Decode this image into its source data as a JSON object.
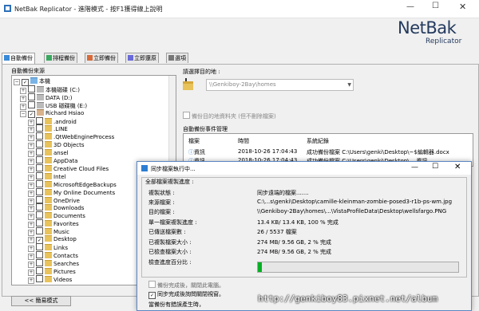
{
  "window": {
    "title": "NetBak Replicator - 進階模式 - 按F1獲得線上說明",
    "min": "—",
    "max": "☐",
    "close": "✕"
  },
  "logo": {
    "line1": "NetBak",
    "line2": "Replicator"
  },
  "tabs": [
    {
      "label": "自動備份",
      "active": true
    },
    {
      "label": "排程備份"
    },
    {
      "label": "立即備份"
    },
    {
      "label": "立即還原"
    },
    {
      "label": "選項"
    }
  ],
  "source": {
    "label": "自動備份來源",
    "tree": [
      {
        "label": "本機",
        "check": "checked",
        "icon": "pc",
        "expand": "−",
        "level": 0
      },
      {
        "label": "本機磁碟 (C:)",
        "check": "empty",
        "icon": "drv",
        "expand": "+",
        "level": 1
      },
      {
        "label": "DATA (D:)",
        "check": "empty",
        "icon": "drv",
        "expand": "+",
        "level": 1
      },
      {
        "label": "USB 磁碟機 (E:)",
        "check": "empty",
        "icon": "drv",
        "expand": "+",
        "level": 1
      },
      {
        "label": "Richard Hsiao",
        "check": "checked",
        "icon": "usr",
        "expand": "−",
        "level": 1
      },
      {
        "label": ".android",
        "check": "empty",
        "icon": "folder",
        "expand": "+",
        "level": 2
      },
      {
        "label": ".LINE",
        "check": "empty",
        "icon": "folder",
        "expand": "+",
        "level": 2
      },
      {
        "label": ".QtWebEngineProcess",
        "check": "empty",
        "icon": "folder",
        "expand": "+",
        "level": 2
      },
      {
        "label": "3D Objects",
        "check": "empty",
        "icon": "folder",
        "expand": "+",
        "level": 2
      },
      {
        "label": "ansel",
        "check": "empty",
        "icon": "folder",
        "expand": "+",
        "level": 2
      },
      {
        "label": "AppData",
        "check": "empty",
        "icon": "folder",
        "expand": "+",
        "level": 2
      },
      {
        "label": "Creative Cloud Files",
        "check": "empty",
        "icon": "folder",
        "expand": "+",
        "level": 2
      },
      {
        "label": "Intel",
        "check": "empty",
        "icon": "folder",
        "expand": "+",
        "level": 2
      },
      {
        "label": "MicrosoftEdgeBackups",
        "check": "empty",
        "icon": "folder",
        "expand": "+",
        "level": 2
      },
      {
        "label": "My Online Documents",
        "check": "empty",
        "icon": "folder",
        "expand": "+",
        "level": 2
      },
      {
        "label": "OneDrive",
        "check": "empty",
        "icon": "folder",
        "expand": "+",
        "level": 2
      },
      {
        "label": "Downloads",
        "check": "empty",
        "icon": "folder",
        "expand": "+",
        "level": 2
      },
      {
        "label": "Documents",
        "check": "empty",
        "icon": "folder",
        "expand": "+",
        "level": 2
      },
      {
        "label": "Favorites",
        "check": "empty",
        "icon": "folder",
        "expand": "+",
        "level": 2
      },
      {
        "label": "Music",
        "check": "empty",
        "icon": "folder",
        "expand": "+",
        "level": 2
      },
      {
        "label": "Desktop",
        "check": "checked",
        "icon": "folder",
        "expand": "+",
        "level": 2
      },
      {
        "label": "Links",
        "check": "empty",
        "icon": "folder",
        "expand": "+",
        "level": 2
      },
      {
        "label": "Contacts",
        "check": "empty",
        "icon": "folder",
        "expand": "+",
        "level": 2
      },
      {
        "label": "Searches",
        "check": "empty",
        "icon": "folder",
        "expand": "+",
        "level": 2
      },
      {
        "label": "Pictures",
        "check": "empty",
        "icon": "folder",
        "expand": "+",
        "level": 2
      },
      {
        "label": "Videos",
        "check": "empty",
        "icon": "folder",
        "expand": "+",
        "level": 2
      }
    ]
  },
  "simple_mode_button": "<< 簡易模式",
  "destination": {
    "label": "請選擇目的地 :",
    "value": "\\\\Genkiboy-2Bay\\homes",
    "mirror_label": "備份目的地資料夾 (但不刪除檔案)"
  },
  "events": {
    "label": "自動備份事件管理",
    "headers": [
      "檔案",
      "時間",
      "系統紀錄"
    ],
    "rows": [
      {
        "type": "資訊",
        "time": "2018-10-26 17:04:43",
        "log": "成功備份檔案 C:\\Users\\genki\\Desktop\\~$編輯器.docx"
      },
      {
        "type": "資訊",
        "time": "2018-10-26 17:04:43",
        "log": "成功備份檔案 C:\\Users\\genki\\Desktop\\... 資訊"
      }
    ]
  },
  "dialog": {
    "title": "同步檔案執行中...",
    "box_title": "全部檔案複製進度 :",
    "labels": {
      "status": "複製狀態 :",
      "source": "來源檔案 :",
      "target": "目的檔案 :",
      "single": "單一檔案複製進度 :",
      "transferred": "已傳送檔案數 :",
      "copied_size": "已複製檔案大小 :",
      "checked_size": "已檢查檔案大小 :",
      "check_pct": "檢查進度百分比 :"
    },
    "values": {
      "status": "同步遠端的檔案.......",
      "source": "C:\\...s\\genki\\Desktop\\camille-kleinman-zombie-posed3-r1b-ps-wm.jpg",
      "target": "\\\\Genkiboy-2Bay\\homes\\...\\VistaProfileData\\Desktop\\wellsfargo.PNG",
      "single": "13.4 KB/ 13.4 KB,   100 % 完成",
      "transferred": "26 / 5537 檔案",
      "copied_size": "274 MB/ 9.56 GB,   2 % 完成",
      "checked_size": "274 MB/ 9.56 GB,   2 % 完成"
    },
    "progress_fraction": 0.02,
    "check_close_label": "備份完成後，關閉此電腦。",
    "check_sync_label": "同步完成後詢問關閉視窗。",
    "bottom_label": "當備份有錯誤產生時，"
  },
  "watermark": "http://genkiboy83.pixnet.net/album",
  "colors": {
    "progress": "#06b025",
    "accent": "#2d7dd2"
  }
}
